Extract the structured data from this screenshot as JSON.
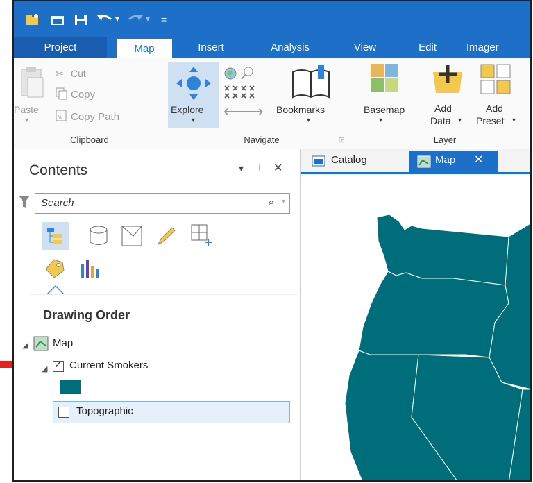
{
  "qat": {
    "undo_icon": "undo-icon",
    "redo_icon": "redo-icon",
    "customize_glyph": "="
  },
  "tabs": [
    "Project",
    "Map",
    "Insert",
    "Analysis",
    "View",
    "Edit",
    "Imager"
  ],
  "ribbon": {
    "clipboard": {
      "paste": "Paste",
      "cut": "Cut",
      "copy": "Copy",
      "copy_path": "Copy Path",
      "label": "Clipboard"
    },
    "navigate": {
      "explore": "Explore",
      "bookmarks": "Bookmarks",
      "label": "Navigate"
    },
    "layer": {
      "basemap": "Basemap",
      "add_data_line1": "Add",
      "add_data_line2": "Data",
      "add_preset_line1": "Add",
      "add_preset_line2": "Preset",
      "label": "Layer"
    }
  },
  "contents": {
    "title": "Contents",
    "search_placeholder": "Search",
    "heading": "Drawing Order",
    "tree": {
      "map": "Map",
      "current_smokers": "Current Smokers",
      "topographic": "Topographic"
    }
  },
  "doc_tabs": {
    "catalog": "Catalog",
    "map": "Map"
  },
  "colors": {
    "accent": "#1d6fc8",
    "layer_fill": "#006d7a",
    "selection": "#e6f0fa",
    "arrow": "#e8201b"
  }
}
